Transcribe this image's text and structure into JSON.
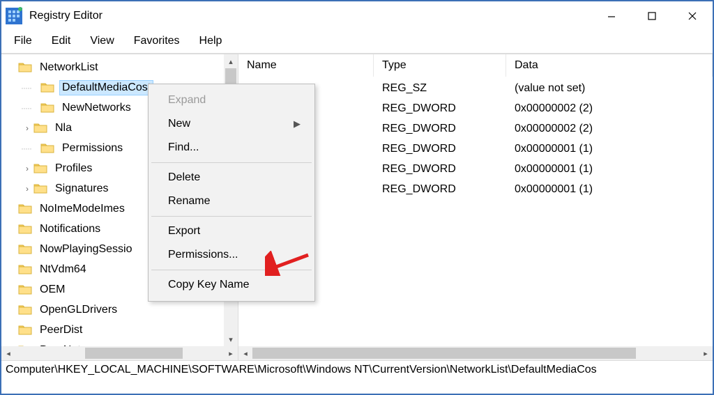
{
  "window": {
    "title": "Registry Editor"
  },
  "menubar": [
    "File",
    "Edit",
    "View",
    "Favorites",
    "Help"
  ],
  "tree": {
    "root": "NetworkList",
    "items": [
      {
        "label": "DefaultMediaCost",
        "selected": true,
        "expandable": false,
        "child": true
      },
      {
        "label": "NewNetworks",
        "expandable": false,
        "child": true
      },
      {
        "label": "Nla",
        "expandable": true,
        "child": true
      },
      {
        "label": "Permissions",
        "expandable": false,
        "child": true
      },
      {
        "label": "Profiles",
        "expandable": true,
        "child": true
      },
      {
        "label": "Signatures",
        "expandable": true,
        "child": true
      },
      {
        "label": "NoImeModeImes",
        "expandable": false,
        "child": false
      },
      {
        "label": "Notifications",
        "expandable": false,
        "child": false
      },
      {
        "label": "NowPlayingSessio",
        "expandable": false,
        "child": false
      },
      {
        "label": "NtVdm64",
        "expandable": false,
        "child": false
      },
      {
        "label": "OEM",
        "expandable": false,
        "child": false
      },
      {
        "label": "OpenGLDrivers",
        "expandable": false,
        "child": false
      },
      {
        "label": "PeerDist",
        "expandable": false,
        "child": false
      },
      {
        "label": "PeerNet",
        "expandable": false,
        "child": false
      }
    ]
  },
  "columns": {
    "name": "Name",
    "type": "Type",
    "data": "Data"
  },
  "rows": [
    {
      "name": "",
      "type": "REG_SZ",
      "data": "(value not set)"
    },
    {
      "name": "",
      "type": "REG_DWORD",
      "data": "0x00000002 (2)"
    },
    {
      "name": "",
      "type": "REG_DWORD",
      "data": "0x00000002 (2)"
    },
    {
      "name": "",
      "type": "REG_DWORD",
      "data": "0x00000001 (1)"
    },
    {
      "name": "",
      "type": "REG_DWORD",
      "data": "0x00000001 (1)"
    },
    {
      "name": "",
      "type": "REG_DWORD",
      "data": "0x00000001 (1)"
    }
  ],
  "context_menu": {
    "items": [
      {
        "label": "Expand",
        "disabled": true
      },
      {
        "label": "New",
        "submenu": true
      },
      {
        "label": "Find..."
      },
      {
        "sep": true
      },
      {
        "label": "Delete"
      },
      {
        "label": "Rename"
      },
      {
        "sep": true
      },
      {
        "label": "Export"
      },
      {
        "label": "Permissions..."
      },
      {
        "sep": true
      },
      {
        "label": "Copy Key Name"
      }
    ]
  },
  "status": "Computer\\HKEY_LOCAL_MACHINE\\SOFTWARE\\Microsoft\\Windows NT\\CurrentVersion\\NetworkList\\DefaultMediaCos"
}
